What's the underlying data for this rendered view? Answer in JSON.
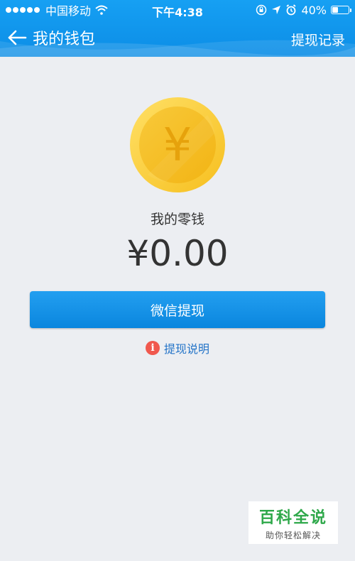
{
  "status_bar": {
    "carrier": "中国移动",
    "time": "下午4:38",
    "battery_percent": "40%",
    "battery_level": 0.4,
    "icons": [
      "signal-icon",
      "wifi-icon",
      "rotation-lock-icon",
      "location-icon",
      "alarm-icon",
      "battery-icon"
    ]
  },
  "navbar": {
    "title": "我的钱包",
    "back_icon": "back-arrow-icon",
    "right_action": "提现记录"
  },
  "wallet": {
    "coin_symbol": "¥",
    "label": "我的零钱",
    "balance": "¥0.00"
  },
  "actions": {
    "withdraw_label": "微信提现",
    "help_label": "提现说明",
    "help_icon": "info-icon"
  },
  "watermark": {
    "title": "百科全说",
    "subtitle": "助你轻松解决"
  },
  "colors": {
    "header": "#0c8de6",
    "background": "#eceef2",
    "button": "#0a86de",
    "coin": "#f8c42a",
    "info_icon": "#f0584e",
    "link": "#2474c8"
  }
}
